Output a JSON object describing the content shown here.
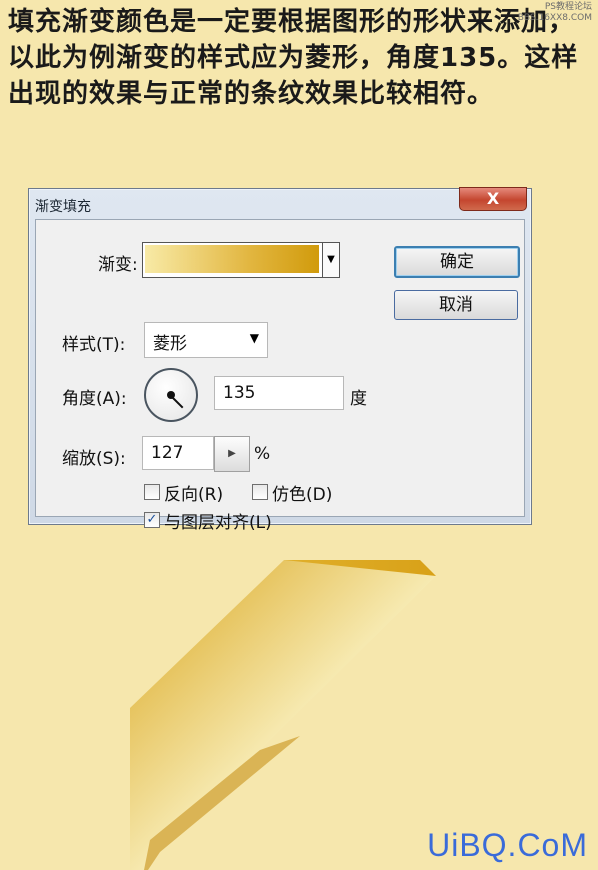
{
  "intro_text": "填充渐变颜色是一定要根据图形的形状来添加，以此为例渐变的样式应为菱形，角度135。这样出现的效果与正常的条纹效果比较相符。",
  "watermark_top": "PS教程论坛",
  "watermark_top_url": "BBS.16XX8.COM",
  "dialog": {
    "title": "渐变填充",
    "close_label": "X",
    "gradient_label": "渐变:",
    "style_label": "样式(T):",
    "style_value": "菱形",
    "angle_label": "角度(A):",
    "angle_value": "135",
    "angle_unit": "度",
    "scale_label": "缩放(S):",
    "scale_value": "127",
    "scale_unit": "%",
    "reverse_label": "反向(R)",
    "reverse_checked": false,
    "dither_label": "仿色(D)",
    "dither_checked": false,
    "align_label": "与图层对齐(L)",
    "align_checked": true,
    "ok_label": "确定",
    "cancel_label": "取消",
    "gradient_colors": [
      "#f8eaa6",
      "#e2b640",
      "#d19b0c"
    ]
  },
  "colors": {
    "background": "#f6e7ad",
    "ribbon_dark": "#d9a51c",
    "ribbon_light": "#f8edb8"
  },
  "watermark_bottom": "UiBQ.CoM"
}
